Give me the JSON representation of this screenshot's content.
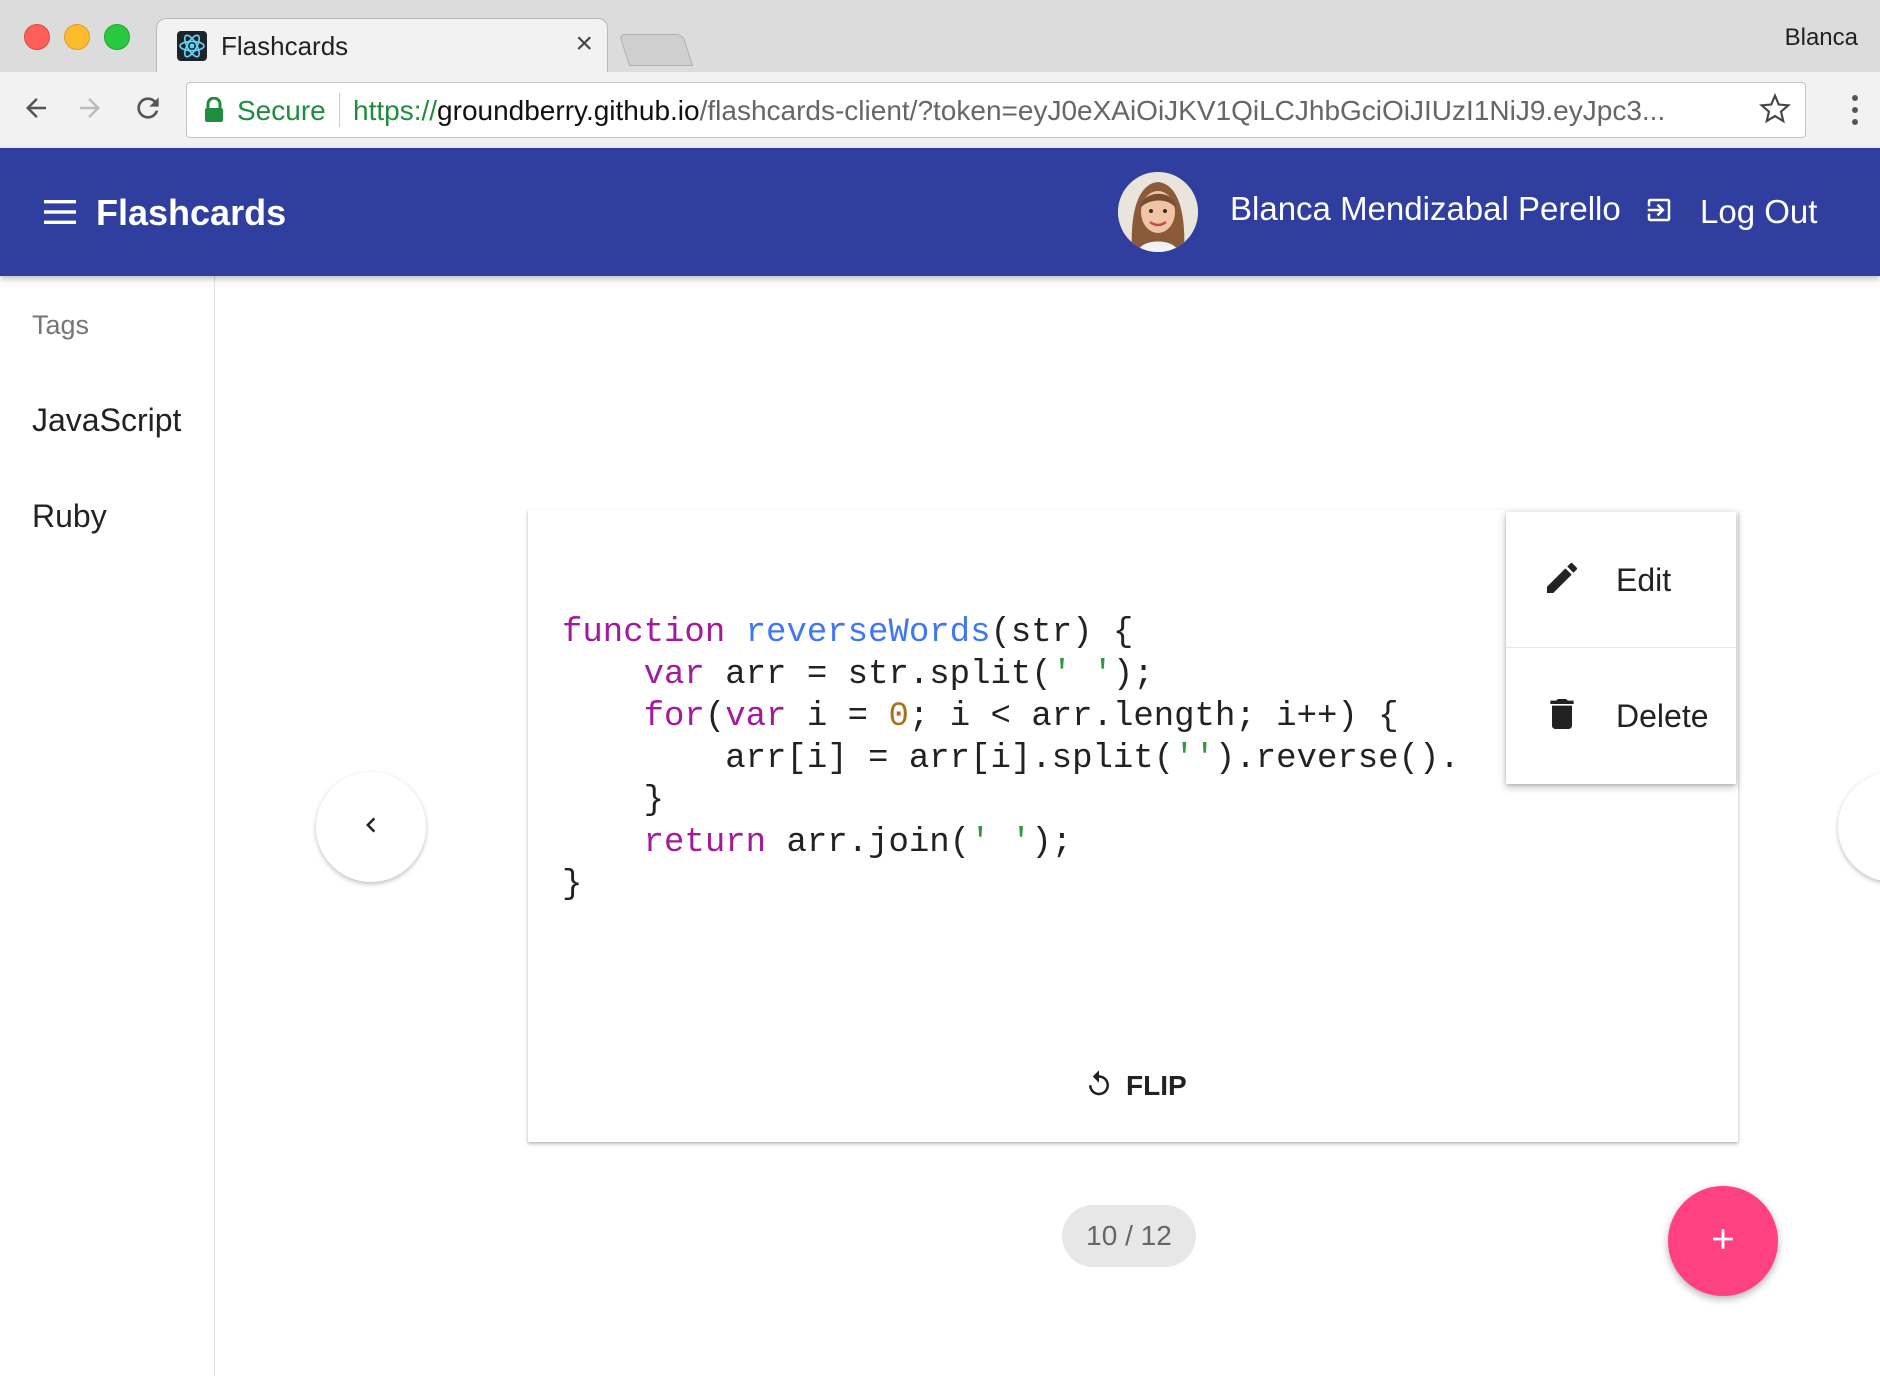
{
  "browser": {
    "tab_title": "Flashcards",
    "tab_close": "×",
    "profile_name": "Blanca",
    "secure_label": "Secure",
    "url_scheme": "https://",
    "url_host": "groundberry.github.io",
    "url_path": "/flashcards-client/?token=eyJ0eXAiOiJKV1QiLCJhbGciOiJIUzI1NiJ9.eyJpc3..."
  },
  "appbar": {
    "title": "Flashcards",
    "user_name": "Blanca Mendizabal Perello",
    "logout_label": "Log Out",
    "color": "#303f9f"
  },
  "sidebar": {
    "header": "Tags",
    "tags": [
      "JavaScript",
      "Ruby"
    ]
  },
  "card": {
    "code_lines": [
      "function reverseWords(str) {",
      "    var arr = str.split(' ');",
      "    for(var i = 0; i < arr.length; i++) {",
      "        arr[i] = arr[i].split('').reverse().",
      "    }",
      "    return arr.join(' ');",
      "}"
    ],
    "flip_label": "FLIP"
  },
  "menu": {
    "edit_label": "Edit",
    "delete_label": "Delete"
  },
  "pager": {
    "counter": "10 / 12",
    "current": 10,
    "total": 12
  },
  "fab": {
    "label": "+",
    "color": "#ff4081"
  },
  "icons": {
    "favicon": "react-atom-icon",
    "back": "arrow-left-icon",
    "forward": "arrow-right-icon",
    "reload": "reload-icon",
    "lock": "lock-icon",
    "star": "star-outline-icon",
    "menu": "hamburger-icon",
    "logout": "exit-icon",
    "edit": "pencil-icon",
    "delete": "trash-icon",
    "flip": "rotate-left-icon",
    "prev": "chevron-left-icon",
    "next": "chevron-right-icon",
    "add": "plus-icon"
  }
}
